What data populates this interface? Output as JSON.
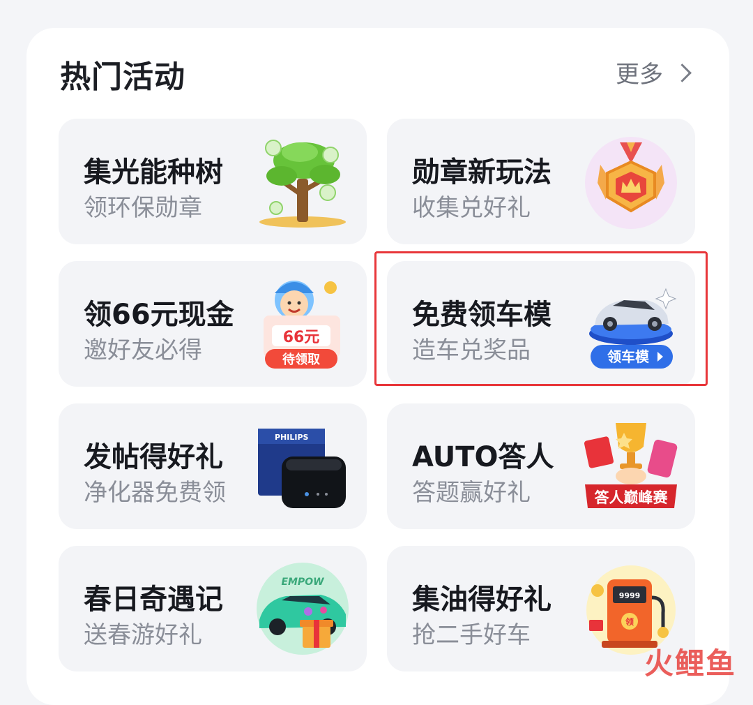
{
  "section": {
    "title": "热门活动",
    "more_label": "更多"
  },
  "cards": [
    {
      "title": "集光能种树",
      "subtitle": "领环保勋章",
      "icon": "tree-icon"
    },
    {
      "title": "勋章新玩法",
      "subtitle": "收集兑好礼",
      "icon": "medal-icon"
    },
    {
      "title": "领66元现金",
      "subtitle": "邀好友必得",
      "icon": "cash-reward-icon",
      "art_amount": "66元",
      "art_button": "待领取"
    },
    {
      "title": "免费领车模",
      "subtitle": "造车兑奖品",
      "icon": "car-model-icon",
      "art_button": "领车模"
    },
    {
      "title": "发帖得好礼",
      "subtitle": "净化器免费领",
      "icon": "air-purifier-icon",
      "art_brand": "PHILIPS"
    },
    {
      "title": "AUTO答人",
      "subtitle": "答题赢好礼",
      "icon": "trophy-icon",
      "art_banner": "答人巅峰赛"
    },
    {
      "title": "春日奇遇记",
      "subtitle": "送春游好礼",
      "icon": "ev-car-icon",
      "art_brand": "EMPOW"
    },
    {
      "title": "集油得好礼",
      "subtitle": "抢二手好车",
      "icon": "fuel-pump-icon",
      "art_meter": "9999",
      "art_badge": "领"
    }
  ],
  "watermark": "火鲤鱼",
  "colors": {
    "highlight": "#e8363a",
    "card_bg": "#f3f4f7"
  }
}
